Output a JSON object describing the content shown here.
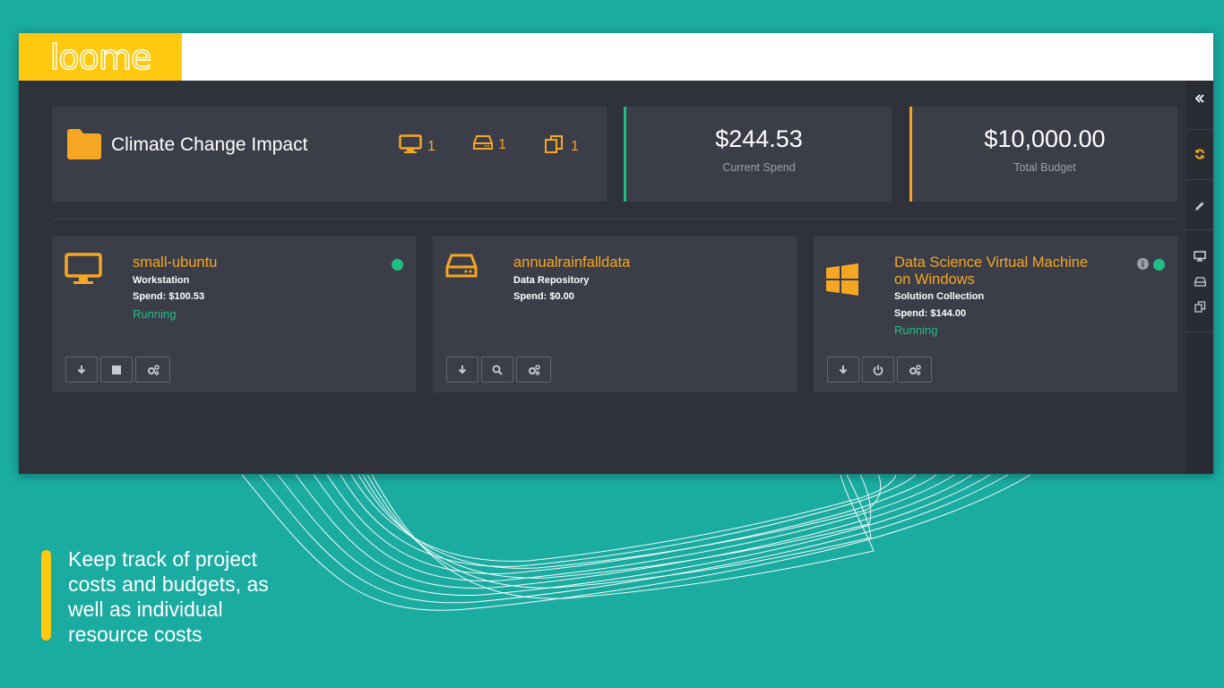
{
  "app": {
    "logo_text": "loome"
  },
  "project": {
    "title": "Climate Change Impact",
    "counts": [
      {
        "icon": "monitor-icon",
        "value": "1"
      },
      {
        "icon": "drive-icon",
        "value": "1"
      },
      {
        "icon": "copy-icon",
        "value": "1"
      }
    ]
  },
  "stats": {
    "current_spend": {
      "value": "$244.53",
      "label": "Current Spend"
    },
    "total_budget": {
      "value": "$10,000.00",
      "label": "Total Budget"
    }
  },
  "resources": [
    {
      "name": "small-ubuntu",
      "type": "Workstation",
      "spend": "Spend: $100.53",
      "status": "Running",
      "icon": "monitor-icon",
      "actions": [
        "download-icon",
        "stop-icon",
        "settings-icon"
      ]
    },
    {
      "name": "annualrainfalldata",
      "type": "Data Repository",
      "spend": "Spend: $0.00",
      "status": "",
      "icon": "drive-icon",
      "actions": [
        "download-icon",
        "search-icon",
        "settings-icon"
      ]
    },
    {
      "name": "Data Science Virtual Machine on Windows",
      "type": "Solution Collection",
      "spend": "Spend: $144.00",
      "status": "Running",
      "icon": "windows-icon",
      "actions": [
        "download-icon",
        "power-icon",
        "settings-icon"
      ]
    }
  ],
  "right_rail": [
    "collapse-icon",
    "refresh-icon",
    "edit-icon",
    "monitor-icon",
    "drive-icon",
    "copy-icon"
  ],
  "caption": "Keep track of project costs and budgets, as well as individual resource costs",
  "colors": {
    "background": "#1aaba1",
    "accent_yellow": "#fec90f",
    "accent_orange": "#f5a623",
    "status_green": "#1fbf84",
    "panel": "#3b3e48",
    "window": "#30323b"
  }
}
